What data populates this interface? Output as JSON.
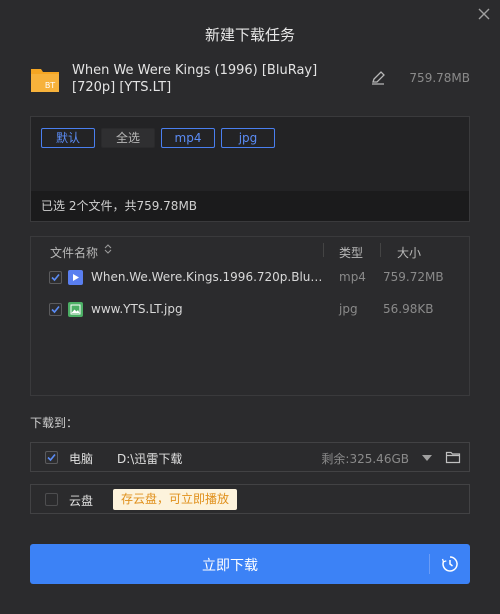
{
  "dialog": {
    "title": "新建下载任务"
  },
  "task": {
    "icon_label": "BT",
    "name": "When We Were Kings (1996) [BluRay] [720p] [YTS.LT]",
    "total_size": "759.78MB"
  },
  "filters": {
    "chips": [
      "默认",
      "全选",
      "mp4",
      "jpg"
    ],
    "selected_summary": "已选 2个文件，共759.78MB"
  },
  "table": {
    "headers": {
      "name": "文件名称",
      "type": "类型",
      "size": "大小"
    },
    "rows": [
      {
        "name": "When.We.Were.Kings.1996.720p.BluR...",
        "type": "mp4",
        "size": "759.72MB",
        "checked": true,
        "icon": "video-file-icon"
      },
      {
        "name": "www.YTS.LT.jpg",
        "type": "jpg",
        "size": "56.98KB",
        "checked": true,
        "icon": "image-file-icon"
      }
    ]
  },
  "destination": {
    "label": "下载到：",
    "pc": {
      "label": "电脑",
      "path": "D:\\迅雷下载",
      "remaining": "剩余:325.46GB",
      "checked": true
    },
    "cloud": {
      "label": "云盘",
      "tip": "存云盘，可立即播放",
      "checked": false
    }
  },
  "actions": {
    "download_label": "立即下载"
  },
  "colors": {
    "accent": "#3c82f6",
    "bt_folder": "#f5a623",
    "video_icon": "#5a7ff0",
    "image_icon": "#4caf65",
    "tip_text": "#e0901c"
  }
}
